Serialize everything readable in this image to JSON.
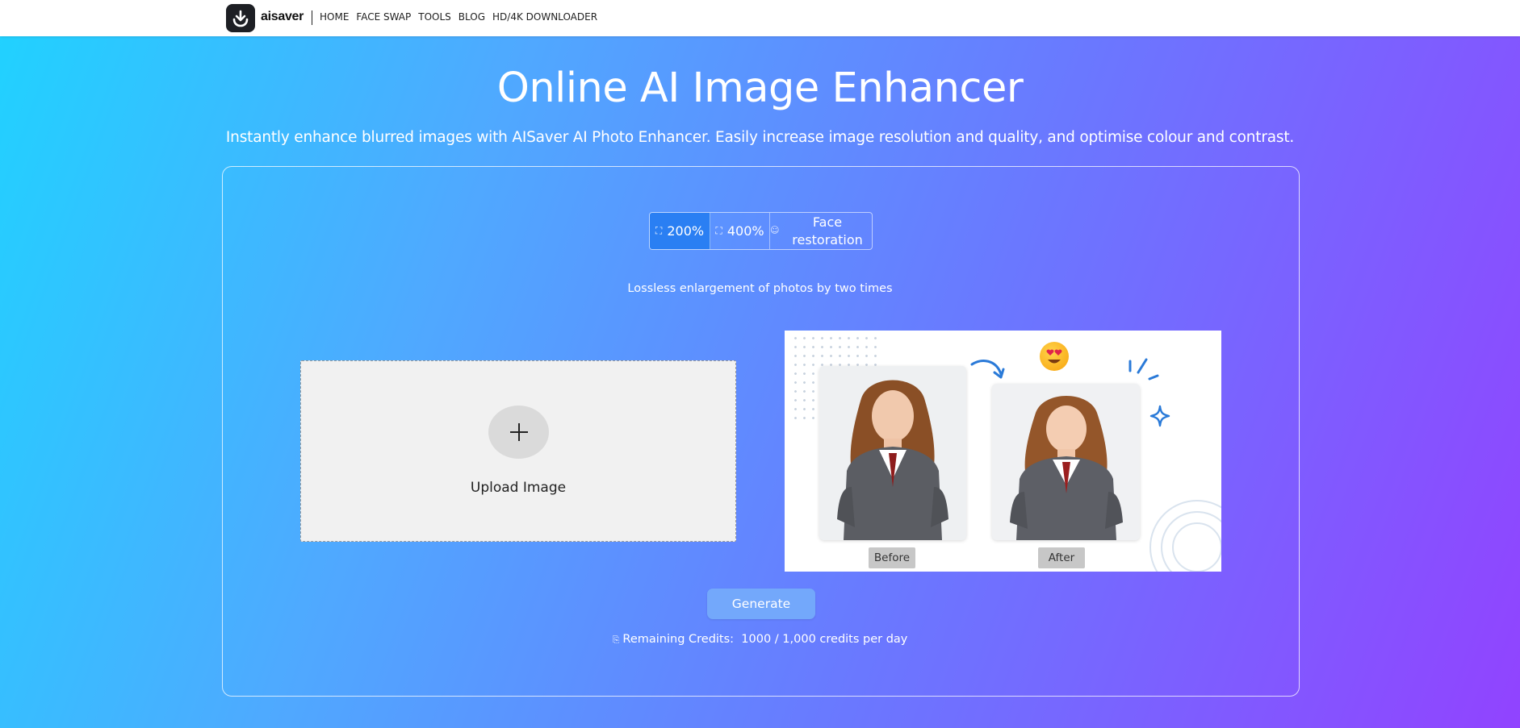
{
  "header": {
    "logo_text": "aisaver",
    "nav": [
      {
        "label": "HOME"
      },
      {
        "label": "FACE SWAP"
      },
      {
        "label": "TOOLS"
      },
      {
        "label": "BLOG"
      },
      {
        "label": "HD/4K DOWNLOADER"
      }
    ]
  },
  "hero": {
    "title": "Online AI Image Enhancer",
    "subtitle": "Instantly enhance blurred images with AISaver AI Photo Enhancer. Easily increase image resolution and quality, and optimise colour and contrast."
  },
  "modes": {
    "selected": "200%",
    "items": [
      {
        "label": "200%",
        "icon": "expand-icon"
      },
      {
        "label": "400%",
        "icon": "expand-icon"
      },
      {
        "label": "Face restoration",
        "icon": "face-icon"
      }
    ],
    "description": "Lossless enlargement of photos by two times"
  },
  "upload": {
    "label": "Upload Image",
    "icon": "plus-icon"
  },
  "example": {
    "before_label": "Before",
    "after_label": "After"
  },
  "generate": {
    "label": "Generate"
  },
  "credits": {
    "label": "Remaining Credits:",
    "value": "1000 / 1,000 credits per day"
  },
  "colors": {
    "accent": "#2a7ff3",
    "generate_button": "#73a8fb",
    "gradient_start": "#20d2ff",
    "gradient_end": "#9143ff"
  }
}
